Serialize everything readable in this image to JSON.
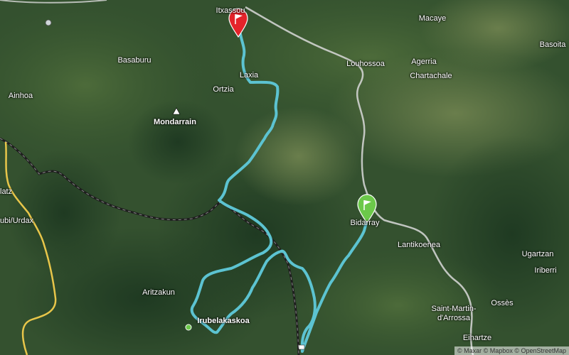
{
  "map": {
    "attribution": "© Maxar © Mapbox © OpenStreetMap",
    "colors": {
      "route": "#5cc3d1",
      "start_flag": "#6cc94a",
      "end_flag": "#e4232a",
      "road": "#cfcfcf",
      "border": "#e8c64a",
      "rail": "#1e1e1e"
    },
    "labels": {
      "itxassou": "Itxassou",
      "macaye": "Macaye",
      "basoita": "Basoita",
      "basaburu": "Basaburu",
      "louhossoa": "Louhossoa",
      "agerria": "Agerria",
      "chartachale": "Chartachale",
      "laxia": "Laxia",
      "ortzia": "Ortzia",
      "ainhoa": "Ainhoa",
      "mondarrain": "Mondarrain",
      "latz": "latz",
      "urdax": "ubi/Urdax",
      "bidarray": "Bidarray",
      "lantikoenea": "Lantikoenea",
      "ugartzan": "Ugartzan",
      "iriberri": "Iriberri",
      "aritzakun": "Aritzakun",
      "irubelakaskoa": "Irubelakaskoa",
      "saint_martin_line1": "Saint-Martin-",
      "saint_martin_line2": "d'Arrossa",
      "osses": "Ossès",
      "eihartze": "Eihartze"
    }
  }
}
